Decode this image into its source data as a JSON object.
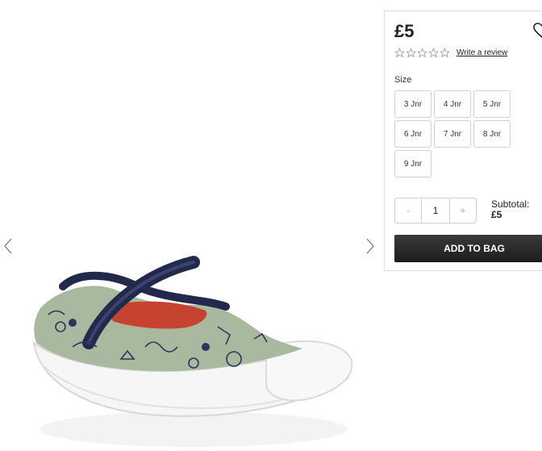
{
  "product": {
    "price": "£5",
    "rating_stars": 0,
    "write_review": "Write a review"
  },
  "sizes": {
    "label": "Size",
    "options": [
      "3 Jnr",
      "4 Jnr",
      "5 Jnr",
      "6 Jnr",
      "7 Jnr",
      "8 Jnr",
      "9 Jnr"
    ]
  },
  "quantity": {
    "minus": "-",
    "value": "1",
    "plus": "+"
  },
  "subtotal": {
    "label": "Subtotal:",
    "value": "£5"
  },
  "add_to_bag": "ADD TO BAG",
  "icons": {
    "wishlist": "heart-outline-icon",
    "prev": "chevron-left-icon",
    "next": "chevron-right-icon",
    "star": "star-outline-icon"
  },
  "colors": {
    "button_bg": "#222222",
    "border": "#d2d2d2"
  }
}
